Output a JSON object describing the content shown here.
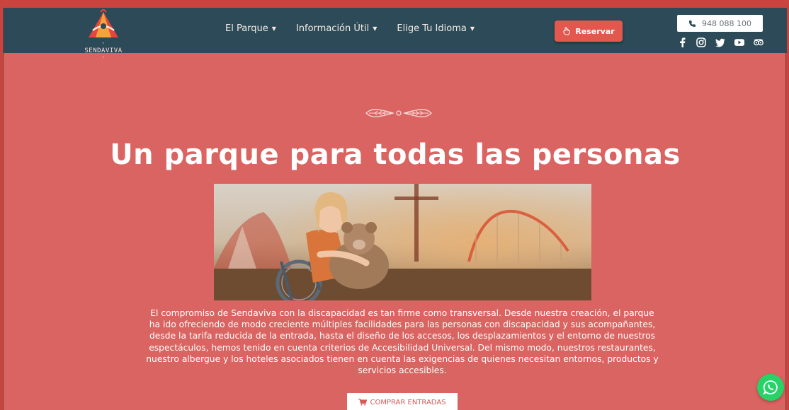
{
  "header": {
    "logo_text": "· SENDAVIVA ·",
    "nav": [
      {
        "label": "El Parque"
      },
      {
        "label": "Información Útil"
      },
      {
        "label": "Elige Tu Idioma"
      }
    ],
    "reserve_label": "Reservar",
    "phone": "948 088 100",
    "social_icons": [
      "facebook-icon",
      "instagram-icon",
      "twitter-icon",
      "youtube-icon",
      "tripadvisor-icon"
    ]
  },
  "hero": {
    "title": "Un parque para todas las personas",
    "body": "El compromiso de Sendaviva con la discapacidad es tan firme como transversal. Desde nuestra creación, el parque ha ido ofreciendo de modo creciente múltiples facilidades para las personas con discapacidad y sus acompañantes, desde la tarifa reducida de la entrada, hasta el diseño de los accesos, los desplazamientos y el entorno de nuestros espectáculos, hemos tenido en cuenta criterios de Accesibilidad Universal. Del mismo modo, nuestros restaurantes, nuestro albergue y los hoteles asociados tienen en cuenta las exigencias de quienes necesitan entornos, productos y servicios accesibles.",
    "cta_label": "COMPRAR ENTRADAS"
  },
  "colors": {
    "header_bg": "#2c4a57",
    "page_bg": "#d96461",
    "reserve_bg": "#e2584f",
    "whatsapp": "#25d366"
  }
}
